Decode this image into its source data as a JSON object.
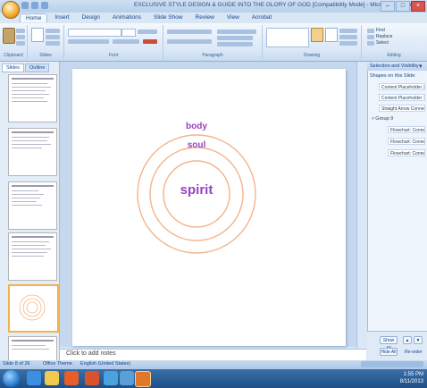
{
  "titlebar": {
    "title": "EXCLUSIVE STYLE DESIGN & GUIDE INTO THE GLORY OF GOD [Compatibility Mode] - Microsoft PowerPoint"
  },
  "ribbon": {
    "tabs": [
      "Home",
      "Insert",
      "Design",
      "Animations",
      "Slide Show",
      "Review",
      "View",
      "Acrobat"
    ],
    "active_tab": "Home",
    "groups": [
      "Clipboard",
      "Slides",
      "Font",
      "Paragraph",
      "Drawing",
      "Editing"
    ],
    "paste_label": "Paste",
    "new_slide_label": "New Slide",
    "editing": [
      "Find",
      "Replace",
      "Select"
    ]
  },
  "left_pane": {
    "tabs": [
      "Slides",
      "Outline"
    ],
    "active_tab": "Slides"
  },
  "slide": {
    "ring_labels": {
      "outer": "body",
      "middle": "soul",
      "inner": "spirit"
    },
    "ring_color": "#f4b48a",
    "label_color": "#9a42bd"
  },
  "notes": {
    "placeholder": "Click to add notes"
  },
  "selection_pane": {
    "title": "Selection and Visibility",
    "subtitle": "Shapes on this Slide:",
    "items": [
      "Content Placeholder 2",
      "Content Placeholder 1",
      "Straight Arrow Connector 4"
    ],
    "group_label": "Group 9",
    "group_items": [
      "Flowchart: Connector 8",
      "Flowchart: Connector 7",
      "Flowchart: Connector 6"
    ],
    "buttons": {
      "show_all": "Show All",
      "hide_all": "Hide All",
      "reorder": "Re-order"
    }
  },
  "statusbar": {
    "slide_info": "Slide 8 of 26",
    "theme": "Office Theme",
    "language": "English (United States)"
  },
  "taskbar": {
    "time": "1:55 PM",
    "date": "8/11/2013"
  }
}
